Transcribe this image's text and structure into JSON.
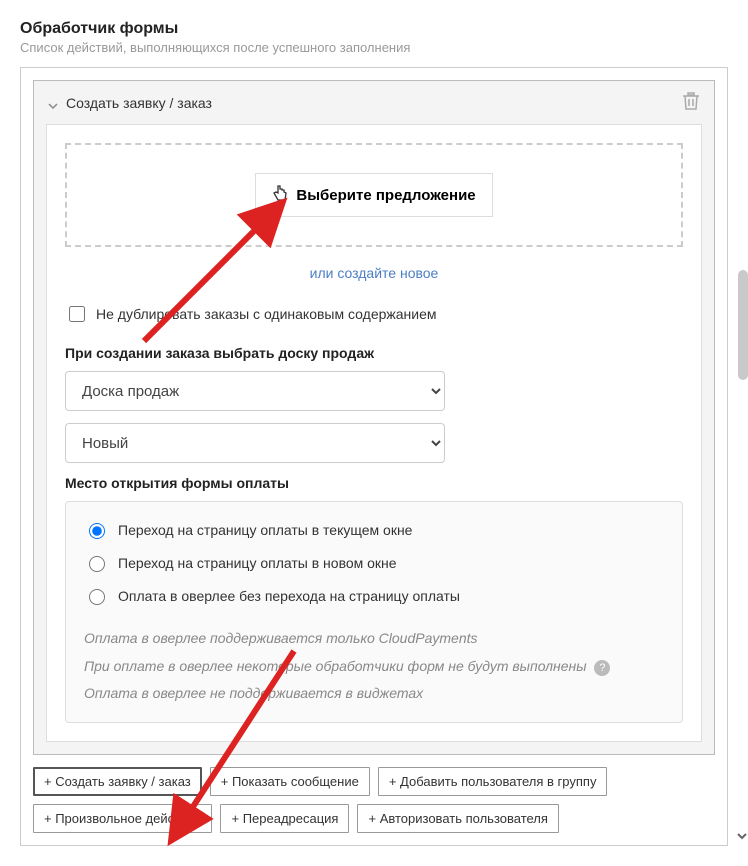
{
  "header": {
    "title": "Обработчик формы",
    "subtitle": "Список действий, выполняющихся после успешного заполнения"
  },
  "action": {
    "title": "Создать заявку / заказ",
    "pick_offer": "Выберите предложение",
    "or_create": "или создайте новое",
    "no_dup": "Не дублировать заказы с одинаковым содержанием",
    "board_label": "При создании заказа выбрать доску продаж",
    "board_select": "Доска продаж",
    "status_select": "Новый",
    "pay_label": "Место открытия формы оплаты",
    "radio1": "Переход на страницу оплаты в текущем окне",
    "radio2": "Переход на страницу оплаты в новом окне",
    "radio3": "Оплата в оверлее без перехода на страницу оплаты",
    "note1": "Оплата в оверлее поддерживается только CloudPayments",
    "note2": "При оплате в оверлее некоторые обработчики форм не будут выполнены",
    "note3": "Оплата в оверлее не поддерживается в виджетах"
  },
  "chips": {
    "c1": "+ Создать заявку / заказ",
    "c2": "+ Показать сообщение",
    "c3": "+ Добавить пользователя в группу",
    "c4": "+ Произвольное действие",
    "c5": "+ Переадресация",
    "c6": "+ Авторизовать пользователя"
  }
}
